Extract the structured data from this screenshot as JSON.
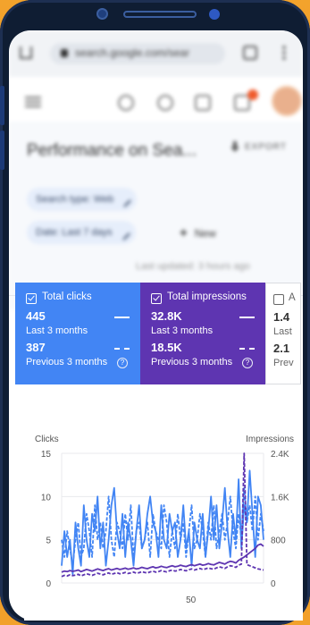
{
  "browser": {
    "url": "search.google.com/sear"
  },
  "header": {
    "title": "Performance on Sea...",
    "export_label": "EXPORT"
  },
  "filters": {
    "search_type": "Search type: Web",
    "date": "Date: Last 7 days",
    "new_label": "New"
  },
  "last_updated": "Last updated: 3 hours ago",
  "metrics": {
    "clicks": {
      "label": "Total clicks",
      "value": "445",
      "period": "Last 3 months",
      "prev_value": "387",
      "prev_period": "Previous 3 months"
    },
    "impressions": {
      "label": "Total impressions",
      "value": "32.8K",
      "period": "Last 3 months",
      "prev_value": "18.5K",
      "prev_period": "Previous 3 months"
    },
    "ctr": {
      "label": "A",
      "value": "1.4",
      "period": "Last",
      "prev_value": "2.1",
      "prev_period": "Prev"
    }
  },
  "colors": {
    "clicks": "#4285f4",
    "impressions": "#5e35b1",
    "background": "#f0a12a"
  },
  "chart_data": {
    "type": "line",
    "ylabel_left": "Clicks",
    "ylabel_right": "Impressions",
    "yticks_left": [
      "15",
      "10",
      "5",
      "0"
    ],
    "yticks_right": [
      "2.4K",
      "1.6K",
      "800",
      "0"
    ],
    "xticks": [
      "50"
    ],
    "ylim_left": [
      0,
      15
    ],
    "ylim_right": [
      0,
      2400
    ],
    "series": [
      {
        "axis": "left",
        "style": "solid",
        "color": "#4285f4",
        "values": [
          2,
          6,
          3,
          5,
          1,
          7,
          4,
          2,
          9,
          5,
          3,
          8,
          6,
          10,
          4,
          7,
          2,
          5,
          9,
          11,
          6,
          4,
          8,
          3,
          7,
          5,
          2,
          6,
          9,
          4,
          5,
          8,
          10,
          7,
          6,
          3,
          9,
          5,
          4,
          8,
          6,
          7,
          3,
          5,
          9,
          4,
          6,
          2,
          7,
          5,
          4,
          8,
          3,
          6,
          10,
          5,
          9,
          4,
          7,
          11,
          6,
          3,
          8,
          5,
          12,
          4,
          9,
          7,
          13,
          8,
          3,
          10,
          9,
          5
        ]
      },
      {
        "axis": "left",
        "style": "dashed",
        "color": "#4285f4",
        "values": [
          5,
          3,
          6,
          4,
          2,
          5,
          7,
          3,
          4,
          8,
          6,
          3,
          9,
          5,
          7,
          4,
          6,
          10,
          5,
          3,
          7,
          6,
          4,
          8,
          5,
          9,
          3,
          6,
          7,
          4,
          5,
          7,
          3,
          8,
          6,
          5,
          4,
          9,
          7,
          3,
          6,
          4,
          8,
          5,
          7,
          3,
          6,
          9,
          4,
          5,
          8,
          6,
          3,
          7,
          5,
          9,
          4,
          6,
          8,
          5,
          7,
          10,
          6,
          4,
          8,
          5,
          11,
          7,
          9,
          6,
          10,
          5,
          8,
          6
        ]
      },
      {
        "axis": "right",
        "style": "solid",
        "color": "#5e35b1",
        "values": [
          200,
          220,
          210,
          230,
          215,
          225,
          240,
          210,
          230,
          250,
          235,
          220,
          240,
          260,
          245,
          230,
          250,
          265,
          240,
          255,
          270,
          250,
          260,
          275,
          255,
          265,
          280,
          260,
          270,
          290,
          275,
          265,
          285,
          300,
          280,
          290,
          310,
          295,
          285,
          305,
          320,
          300,
          310,
          330,
          315,
          305,
          325,
          340,
          320,
          335,
          350,
          330,
          340,
          360,
          345,
          335,
          360,
          380,
          365,
          350,
          380,
          400,
          390,
          370,
          420,
          450,
          480,
          520,
          560,
          600,
          640,
          700,
          720,
          680
        ]
      },
      {
        "axis": "right",
        "style": "dashed",
        "color": "#5e35b1",
        "values": [
          120,
          140,
          130,
          150,
          135,
          145,
          160,
          130,
          150,
          170,
          155,
          140,
          160,
          180,
          165,
          150,
          170,
          185,
          160,
          175,
          190,
          170,
          180,
          195,
          175,
          185,
          200,
          180,
          190,
          210,
          195,
          185,
          205,
          220,
          200,
          210,
          230,
          215,
          205,
          225,
          240,
          220,
          230,
          250,
          235,
          225,
          245,
          260,
          240,
          255,
          270,
          250,
          260,
          280,
          265,
          255,
          280,
          300,
          285,
          270,
          300,
          320,
          310,
          290,
          330,
          350,
          2400,
          340,
          320,
          300,
          280,
          260,
          250,
          240
        ]
      }
    ]
  }
}
